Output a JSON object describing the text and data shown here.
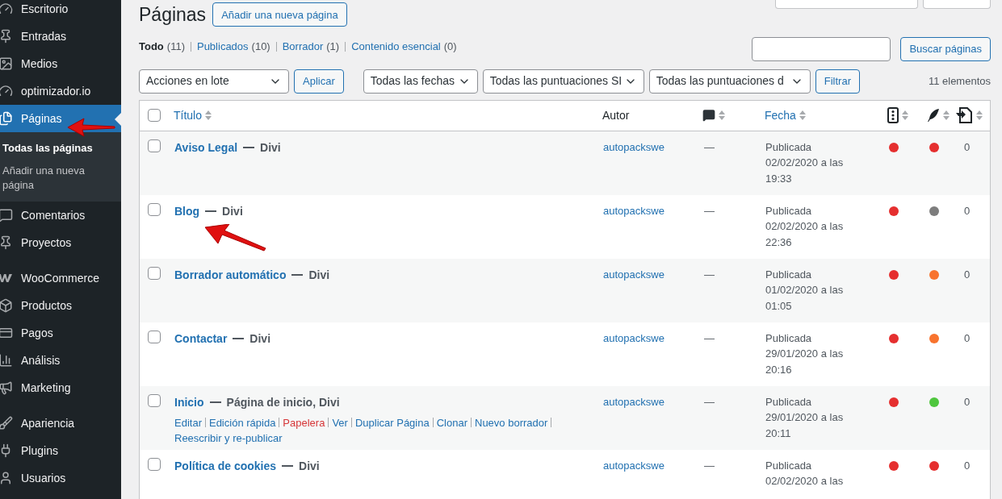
{
  "sidebar": {
    "groups": [
      {
        "items": [
          {
            "label": "Escritorio",
            "selected": false
          },
          {
            "label": "Entradas",
            "selected": false
          },
          {
            "label": "Medios",
            "selected": false
          },
          {
            "label": "optimizador.io",
            "selected": false
          },
          {
            "label": "Páginas",
            "selected": true,
            "submenu": [
              {
                "label": "Todas las páginas",
                "selected": true
              },
              {
                "label": "Añadir una nueva página",
                "selected": false
              }
            ]
          },
          {
            "label": "Comentarios",
            "selected": false
          },
          {
            "label": "Proyectos",
            "selected": false
          }
        ]
      },
      {
        "items": [
          {
            "label": "WooCommerce",
            "selected": false
          },
          {
            "label": "Productos",
            "selected": false
          },
          {
            "label": "Pagos",
            "selected": false
          },
          {
            "label": "Análisis",
            "selected": false
          },
          {
            "label": "Marketing",
            "selected": false
          }
        ]
      },
      {
        "items": [
          {
            "label": "Apariencia",
            "selected": false
          },
          {
            "label": "Plugins",
            "selected": false
          },
          {
            "label": "Usuarios",
            "selected": false
          }
        ]
      }
    ]
  },
  "page": {
    "title": "Páginas",
    "add_button": "Añadir una nueva página"
  },
  "views": [
    {
      "label": "Todo",
      "count": "(11)",
      "selected": true
    },
    {
      "label": "Publicados",
      "count": "(10)",
      "selected": false
    },
    {
      "label": "Borrador",
      "count": "(1)",
      "selected": false
    },
    {
      "label": "Contenido esencial",
      "count": "(0)",
      "selected": false
    }
  ],
  "search": {
    "button": "Buscar páginas"
  },
  "bulk": {
    "select": "Acciones en lote",
    "apply": "Aplicar"
  },
  "filters": {
    "selects": [
      "Todas las fechas",
      "Todas las puntuaciones SI",
      "Todas las puntuaciones d"
    ],
    "button": "Filtrar"
  },
  "count": "11 elementos",
  "table": {
    "select_all_checked": false,
    "columns": {
      "title": "Título",
      "author": "Autor",
      "date": "Fecha"
    },
    "rows": [
      {
        "title": "Aviso Legal",
        "state": "Divi",
        "checked": false,
        "author": "autopackswe",
        "comments": "—",
        "date": [
          "Publicada",
          "02/02/2020 a las",
          "19:33"
        ],
        "seo": {
          "color": "#e52f2f"
        },
        "readability": {
          "color": "#e52f2f"
        },
        "links": "0"
      },
      {
        "title": "Blog",
        "state": "Divi",
        "checked": false,
        "author": "autopackswe",
        "comments": "—",
        "date": [
          "Publicada",
          "02/02/2020 a las",
          "22:36"
        ],
        "seo": {
          "color": "#e52f2f"
        },
        "readability": {
          "color": "#7d7d7d"
        },
        "links": "0"
      },
      {
        "title": "Borrador automático",
        "state": "Divi",
        "checked": false,
        "author": "autopackswe",
        "comments": "—",
        "date": [
          "Publicada",
          "01/02/2020 a las",
          "01:05"
        ],
        "seo": {
          "color": "#e52f2f"
        },
        "readability": {
          "color": "#f8732e"
        },
        "links": "0"
      },
      {
        "title": "Contactar",
        "state": "Divi",
        "checked": false,
        "author": "autopackswe",
        "comments": "—",
        "date": [
          "Publicada",
          "29/01/2020 a las",
          "20:16"
        ],
        "seo": {
          "color": "#e52f2f"
        },
        "readability": {
          "color": "#f8732e"
        },
        "links": "0"
      },
      {
        "title": "Inicio",
        "state": "Página de inicio, Divi",
        "checked": false,
        "author": "autopackswe",
        "comments": "—",
        "date": [
          "Publicada",
          "29/01/2020 a las",
          "20:11"
        ],
        "seo": {
          "color": "#e52f2f"
        },
        "readability": {
          "color": "#4fc63e"
        },
        "links": "0",
        "actions": [
          {
            "label": "Editar",
            "kind": "normal"
          },
          {
            "label": "Edición rápida",
            "kind": "normal"
          },
          {
            "label": "Papelera",
            "kind": "delete"
          },
          {
            "label": "Ver",
            "kind": "normal"
          },
          {
            "label": "Duplicar Página",
            "kind": "normal"
          },
          {
            "label": "Clonar",
            "kind": "normal"
          },
          {
            "label": "Nuevo borrador",
            "kind": "normal"
          },
          {
            "label": "Reescribir y re-publicar",
            "kind": "normal"
          }
        ]
      },
      {
        "title": "Política de cookies",
        "state": "Divi",
        "checked": false,
        "author": "autopackswe",
        "comments": "—",
        "date": [
          "Publicada",
          "02/02/2020 a las"
        ],
        "seo": {
          "color": "#e52f2f"
        },
        "readability": {
          "color": "#e52f2f"
        },
        "links": "0"
      }
    ]
  }
}
